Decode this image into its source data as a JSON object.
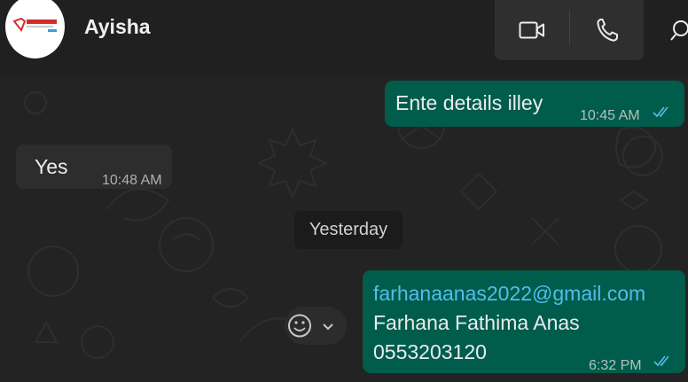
{
  "header": {
    "contact_name": "Ayisha",
    "avatar_logo_text": "REDTEAM",
    "icons": [
      "video-call-icon",
      "voice-call-icon",
      "search-icon"
    ]
  },
  "messages": [
    {
      "id": "m1",
      "direction": "outgoing",
      "text": "Ente details illey",
      "time": "10:45 AM",
      "status": "read"
    },
    {
      "id": "m2",
      "direction": "incoming",
      "text": "Yes",
      "time": "10:48 AM"
    },
    {
      "id": "m3",
      "direction": "outgoing",
      "lines": [
        "farhanaanas2022@gmail.com",
        "Farhana Fathima Anas",
        "0553203120"
      ],
      "time": "6:32 PM",
      "status": "read"
    }
  ],
  "date_divider": "Yesterday",
  "colors": {
    "outgoing_bubble": "#005c4b",
    "incoming_bubble": "#2d2d2d",
    "background": "#232323",
    "link": "#53bdeb",
    "read_ticks": "#53bdeb"
  }
}
